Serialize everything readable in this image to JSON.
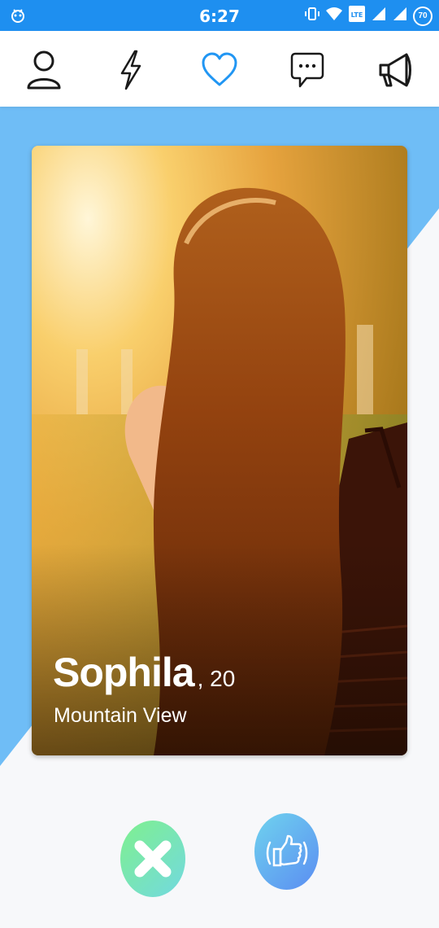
{
  "status_bar": {
    "time": "6:27",
    "battery": "70",
    "icons": [
      "notification-icon",
      "vibrate-icon",
      "wifi-icon",
      "volte-icon",
      "signal-icon",
      "signal-icon-2",
      "battery-icon"
    ]
  },
  "nav": {
    "items": [
      {
        "name": "profile",
        "icon": "person-icon",
        "active": false
      },
      {
        "name": "boost",
        "icon": "lightning-icon",
        "active": false
      },
      {
        "name": "matches",
        "icon": "heart-icon",
        "active": true
      },
      {
        "name": "messages",
        "icon": "chat-icon",
        "active": false
      },
      {
        "name": "announcements",
        "icon": "megaphone-icon",
        "active": false
      }
    ],
    "active_color": "#2196f3",
    "icon_color": "#1a1a1a"
  },
  "card": {
    "name": "Sophila",
    "age": ", 20",
    "location": "Mountain View"
  },
  "actions": {
    "dislike_icon": "close-icon",
    "like_icon": "thumbs-up-icon"
  },
  "colors": {
    "status_bar": "#1e8ff0",
    "background_blue": "#6fbdf6",
    "background_light": "#f7f8fa"
  }
}
